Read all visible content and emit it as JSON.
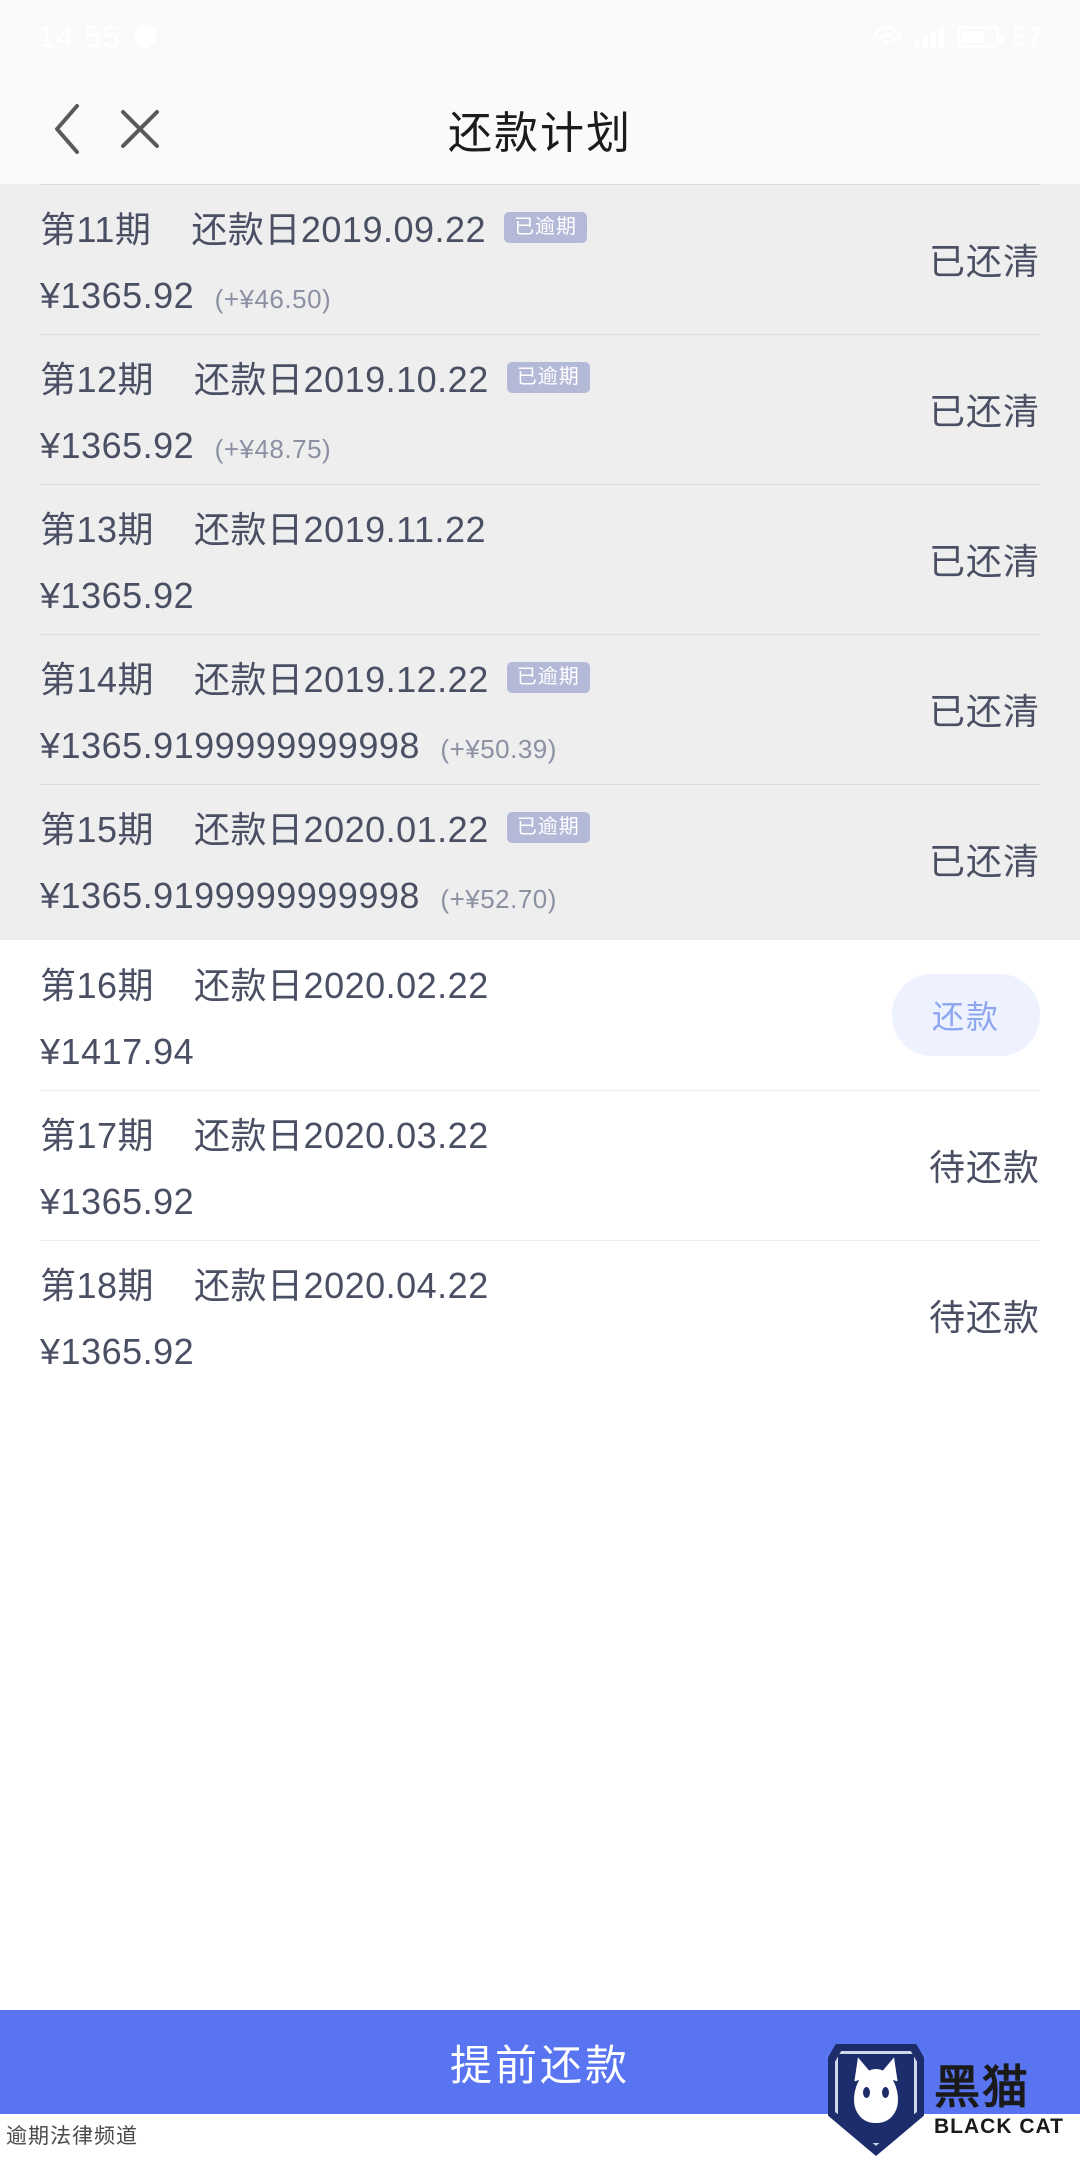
{
  "status_bar": {
    "time": "14:55",
    "battery_percent": "57",
    "icons": [
      "shield-icon",
      "wifi-icon",
      "signal-icon",
      "battery-icon"
    ]
  },
  "nav": {
    "back_icon": "chevron-left-icon",
    "close_icon": "close-icon",
    "title": "还款计划"
  },
  "labels": {
    "overdue_badge": "已逾期",
    "status_paid": "已还清",
    "status_pending": "待还款",
    "repay_button": "还款",
    "currency": "¥"
  },
  "installments_paid": [
    {
      "term": "第11期",
      "due_label": "还款日2019.09.22",
      "badge": "已逾期",
      "amount": "¥1365.92",
      "extra": "(+¥46.50)",
      "status": "已还清"
    },
    {
      "term": "第12期",
      "due_label": "还款日2019.10.22",
      "badge": "已逾期",
      "amount": "¥1365.92",
      "extra": "(+¥48.75)",
      "status": "已还清"
    },
    {
      "term": "第13期",
      "due_label": "还款日2019.11.22",
      "badge": "",
      "amount": "¥1365.92",
      "extra": "",
      "status": "已还清"
    },
    {
      "term": "第14期",
      "due_label": "还款日2019.12.22",
      "badge": "已逾期",
      "amount": "¥1365.9199999999998",
      "extra": "(+¥50.39)",
      "status": "已还清"
    },
    {
      "term": "第15期",
      "due_label": "还款日2020.01.22",
      "badge": "已逾期",
      "amount": "¥1365.9199999999998",
      "extra": "(+¥52.70)",
      "status": "已还清"
    }
  ],
  "installments_due": [
    {
      "term": "第16期",
      "due_label": "还款日2020.02.22",
      "badge": "",
      "amount": "¥1417.94",
      "extra": "",
      "status": "",
      "action": "还款"
    },
    {
      "term": "第17期",
      "due_label": "还款日2020.03.22",
      "badge": "",
      "amount": "¥1365.92",
      "extra": "",
      "status": "待还款",
      "action": ""
    },
    {
      "term": "第18期",
      "due_label": "还款日2020.04.22",
      "badge": "",
      "amount": "¥1365.92",
      "extra": "",
      "status": "待还款",
      "action": ""
    }
  ],
  "bottom": {
    "prepay_label": "提前还款",
    "accent_color": "#5874f1"
  },
  "watermark": {
    "channel": "逾期法律频道",
    "brand_cn": "黑猫",
    "brand_en": "BLACK CAT"
  }
}
